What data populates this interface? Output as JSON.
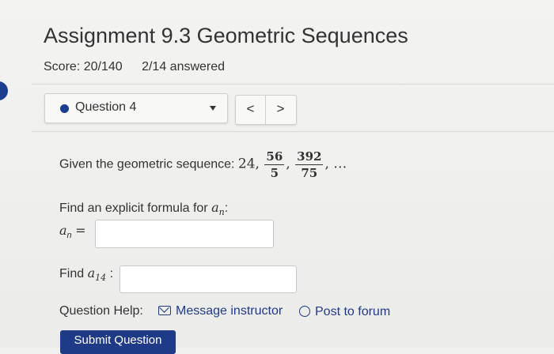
{
  "assignment": {
    "title": "Assignment 9.3 Geometric Sequences",
    "score": "Score: 20/140",
    "answered": "2/14 answered"
  },
  "question_nav": {
    "selected": "Question 4",
    "prev_glyph": "<",
    "next_glyph": ">"
  },
  "question": {
    "prompt": "Given the geometric sequence:",
    "first_term": "24,",
    "term2_num": "56",
    "term2_den": "5",
    "term3_num": "392",
    "term3_den": "75",
    "sep": ",",
    "trailing": ", …"
  },
  "part1": {
    "prompt": "Find an explicit formula for",
    "var": "a",
    "sub": "n",
    "suffix": ":",
    "answer_label_var": "a",
    "answer_label_sub": "n",
    "answer_label_eq": "=",
    "answer_value": ""
  },
  "part2": {
    "prompt": "Find",
    "var": "a",
    "sub": "14",
    "suffix": ":",
    "answer_value": ""
  },
  "help": {
    "label": "Question Help:",
    "message_link": "Message instructor",
    "forum_link": "Post to forum"
  },
  "submit": {
    "label": "Submit Question"
  },
  "colors": {
    "accent": "#1f3a86",
    "bullet": "#1b3e8f"
  }
}
